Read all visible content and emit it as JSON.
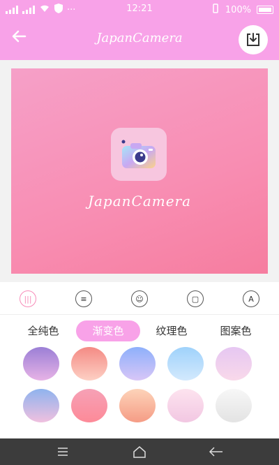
{
  "status": {
    "time": "12:21",
    "battery": "100%",
    "more": "···"
  },
  "header": {
    "title": "JapanCamera"
  },
  "preview": {
    "logo_text": "JapanCamera"
  },
  "tools": [
    {
      "icon": "gradient-tool-icon",
      "glyph": "|||"
    },
    {
      "icon": "list-tool-icon",
      "glyph": "≡"
    },
    {
      "icon": "smile-tool-icon",
      "glyph": "☺"
    },
    {
      "icon": "frame-tool-icon",
      "glyph": "▢"
    },
    {
      "icon": "text-tool-icon",
      "glyph": "A"
    }
  ],
  "tabs": {
    "solid": "全纯色",
    "gradient": "渐变色",
    "texture": "纹理色",
    "pattern": "图案色"
  },
  "swatches": [
    [
      "#9b7fd6",
      "#e7b3e6"
    ],
    [
      "#f48a84",
      "#fdd0c4"
    ],
    [
      "#8eb0fb",
      "#d8c6f7"
    ],
    [
      "#9fd2fb",
      "#d3e9fd"
    ],
    [
      "#e6c7f2",
      "#f9d9ea"
    ],
    [
      "#8fb3ee",
      "#f0c0df"
    ],
    [
      "#f6a1b6",
      "#fd8a98"
    ],
    [
      "#fdd3b9",
      "#f59c85"
    ],
    [
      "#fde3ef",
      "#f2c7e2"
    ],
    [
      "#f7f7f7",
      "#e3e3e3"
    ]
  ],
  "colors": {
    "accent": "#f8a2e8",
    "nav_bar": "#3c3c3c"
  }
}
